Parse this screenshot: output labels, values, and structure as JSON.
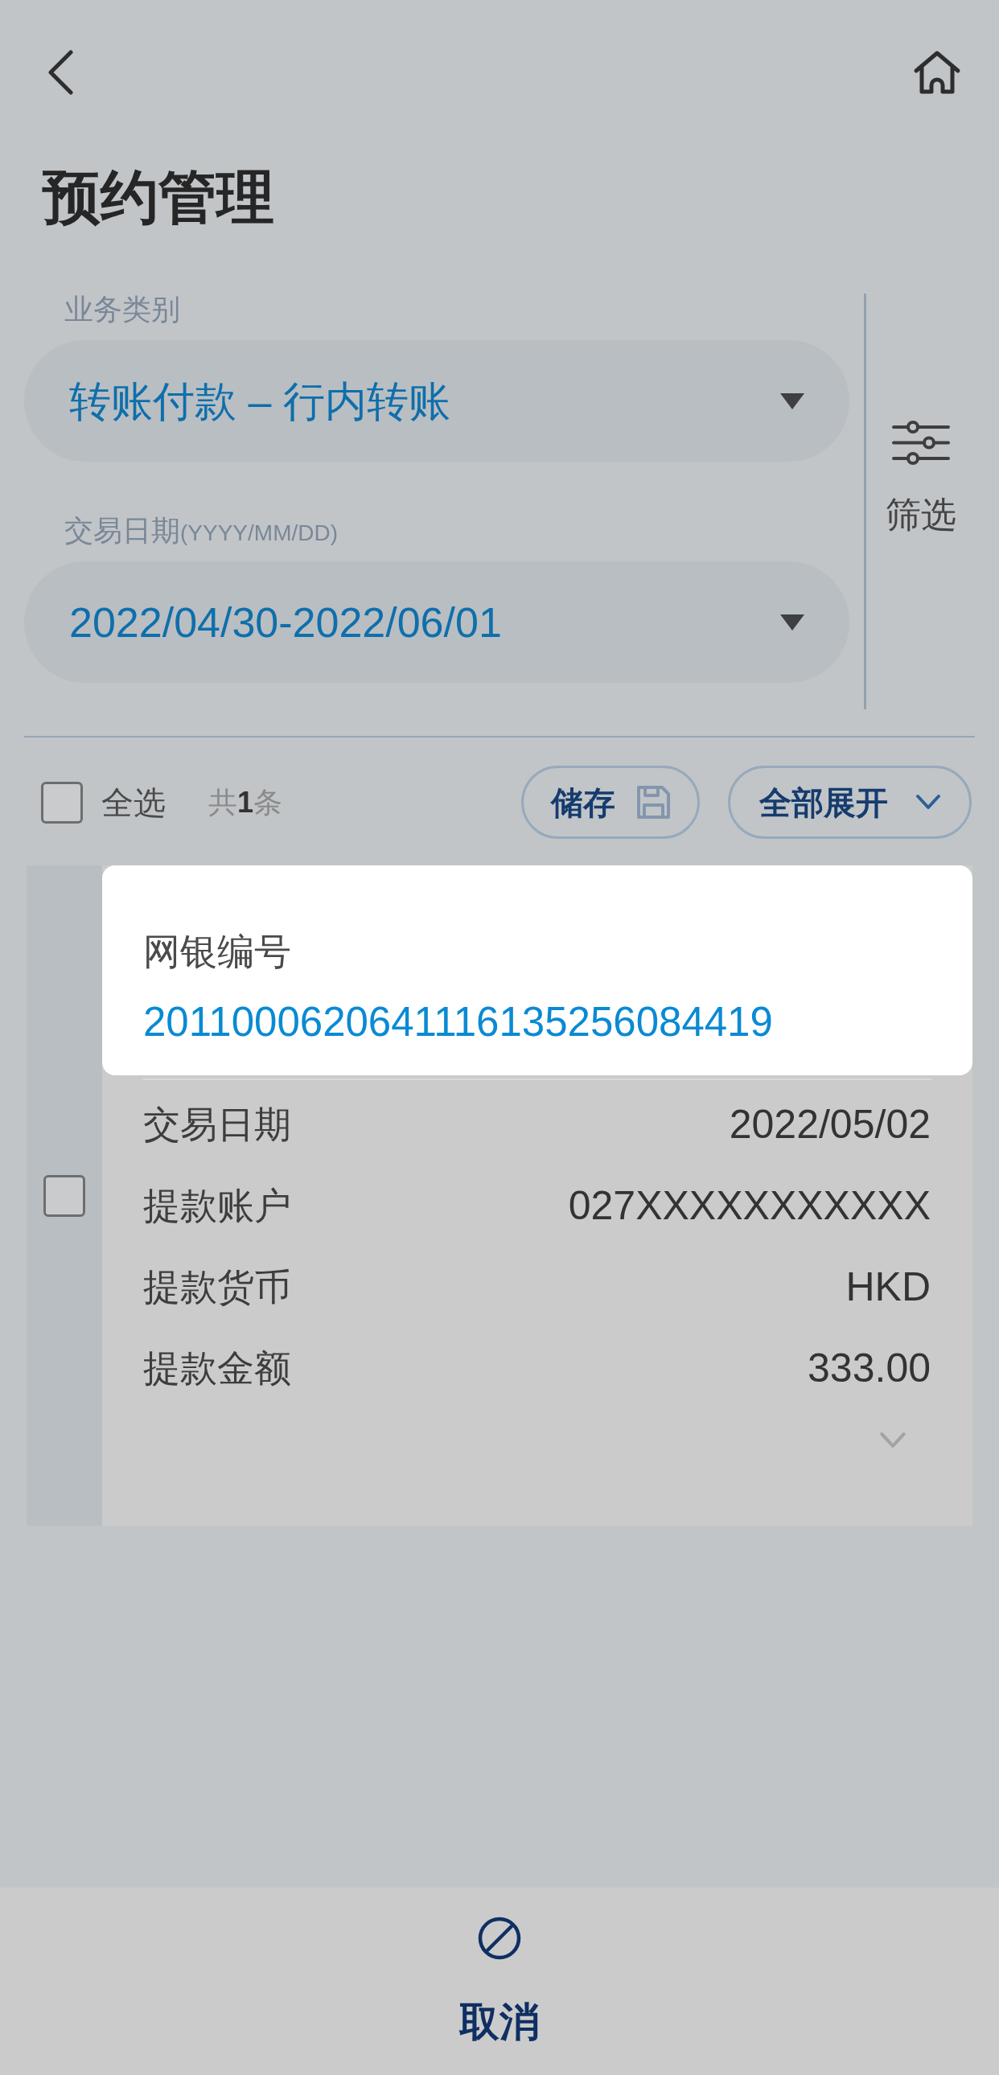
{
  "nav": {
    "title": "预约管理"
  },
  "filters": [
    {
      "label": "业务类别",
      "value": "转账付款 – 行内转账"
    },
    {
      "label": "交易日期",
      "format": "(YYYY/MM/DD)",
      "value": "2022/04/30-2022/06/01"
    }
  ],
  "filter_button": {
    "label": "筛选"
  },
  "toolbar": {
    "select_all": {
      "label": "全选",
      "checked": false
    },
    "count": "共**1**条",
    "buttons": [
      {
        "kind": "save",
        "label": "储存"
      },
      {
        "kind": "expand",
        "label": "全部展开"
      }
    ]
  },
  "records": [
    {
      "checked": false,
      "expanded": false,
      "header": {
        "label": "网银编号",
        "value": "2011000620641116135256084419",
        "highlighted": true
      },
      "fields": [
        {
          "label": "交易日期",
          "value": "2022/05/02"
        },
        {
          "label": "提款账户",
          "value": "027XXXXXXXXXXX"
        },
        {
          "label": "提款货币",
          "value": "HKD"
        },
        {
          "label": "提款金额",
          "value": "333.00"
        }
      ]
    }
  ],
  "footer": {
    "action": {
      "label": "取消"
    }
  }
}
